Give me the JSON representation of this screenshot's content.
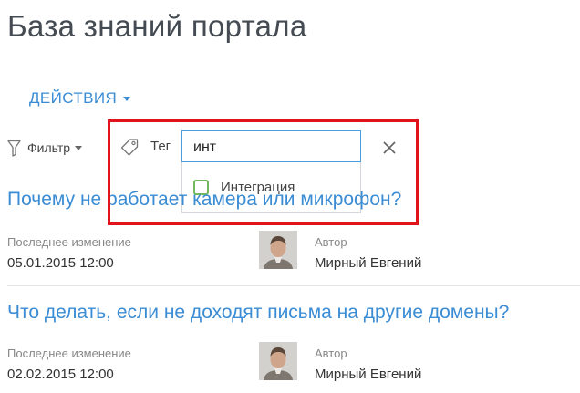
{
  "page": {
    "title": "База знаний портала",
    "actions_label": "ДЕЙСТВИЯ"
  },
  "filter": {
    "filter_label": "Фильтр",
    "tag_label": "Тег",
    "tag_input_value": "инт",
    "suggestion": "Интеграция"
  },
  "articles": [
    {
      "title": "Почему не работает камера или микрофон?",
      "modified_label": "Последнее изменение",
      "modified_value": "05.01.2015 12:00",
      "author_label": "Автор",
      "author_name": "Мирный Евгений"
    },
    {
      "title": "Что делать, если не доходят письма на другие домены?",
      "modified_label": "Последнее изменение",
      "modified_value": "02.02.2015 12:00",
      "author_label": "Автор",
      "author_name": "Мирный Евгений"
    }
  ],
  "colors": {
    "accent": "#3a8cd4",
    "highlight": "#e2141b",
    "checkbox": "#74b85e",
    "title_text": "#444b52"
  },
  "icons": [
    "chevron-down-icon",
    "funnel-icon",
    "tag-icon",
    "close-icon",
    "checkbox-icon"
  ]
}
